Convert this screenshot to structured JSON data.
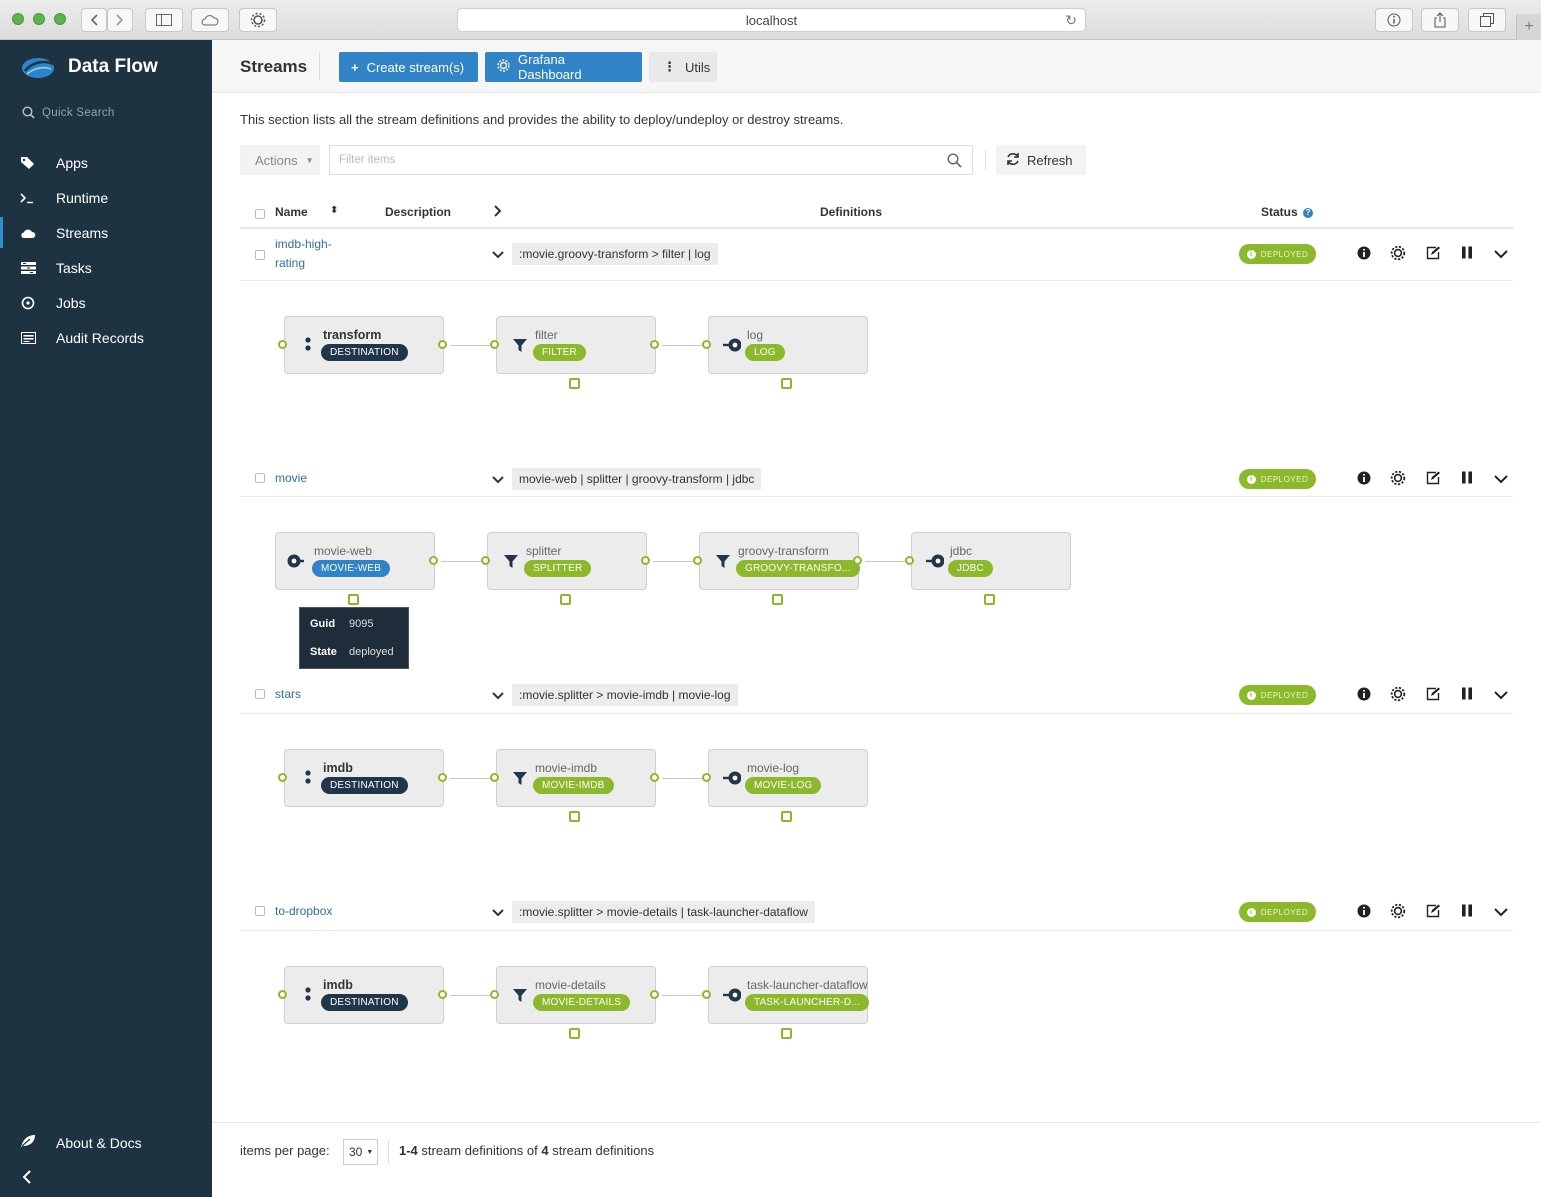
{
  "browser": {
    "url": "localhost"
  },
  "app": {
    "title": "Data Flow",
    "search_placeholder": "Quick Search"
  },
  "sidebar": {
    "items": [
      {
        "label": "Apps"
      },
      {
        "label": "Runtime"
      },
      {
        "label": "Streams",
        "active": true
      },
      {
        "label": "Tasks"
      },
      {
        "label": "Jobs"
      },
      {
        "label": "Audit Records"
      }
    ],
    "about_label": "About & Docs"
  },
  "toolbar": {
    "page_title": "Streams",
    "create_label": "Create stream(s)",
    "grafana_label": "Grafana Dashboard",
    "utils_label": "Utils"
  },
  "description": "This section lists all the stream definitions and provides the ability to deploy/undeploy or destroy streams.",
  "filter": {
    "actions_label": "Actions",
    "placeholder": "Filter items",
    "refresh_label": "Refresh"
  },
  "table": {
    "headers": {
      "name": "Name",
      "description": "Description",
      "definitions": "Definitions",
      "status": "Status"
    },
    "rows": [
      {
        "name": "imdb-high-rating",
        "definition": ":movie.groovy-transform > filter | log",
        "status": "DEPLOYED",
        "nodes": [
          {
            "label": "transform",
            "tag": "DESTINATION",
            "kind": "destination"
          },
          {
            "label": "filter",
            "tag": "FILTER",
            "kind": "processor"
          },
          {
            "label": "log",
            "tag": "LOG",
            "kind": "sink"
          }
        ]
      },
      {
        "name": "movie",
        "definition": "movie-web | splitter | groovy-transform | jdbc",
        "status": "DEPLOYED",
        "nodes": [
          {
            "label": "movie-web",
            "tag": "MOVIE-WEB",
            "kind": "source"
          },
          {
            "label": "splitter",
            "tag": "SPLITTER",
            "kind": "processor"
          },
          {
            "label": "groovy-transform",
            "tag": "GROOVY-TRANSFO...",
            "kind": "processor"
          },
          {
            "label": "jdbc",
            "tag": "JDBC",
            "kind": "sink"
          }
        ],
        "tooltip": {
          "guid_key": "Guid",
          "guid_value": "9095",
          "state_key": "State",
          "state_value": "deployed"
        }
      },
      {
        "name": "stars",
        "definition": ":movie.splitter > movie-imdb | movie-log",
        "status": "DEPLOYED",
        "nodes": [
          {
            "label": "imdb",
            "tag": "DESTINATION",
            "kind": "destination"
          },
          {
            "label": "movie-imdb",
            "tag": "MOVIE-IMDB",
            "kind": "processor"
          },
          {
            "label": "movie-log",
            "tag": "MOVIE-LOG",
            "kind": "sink"
          }
        ]
      },
      {
        "name": "to-dropbox",
        "definition": ":movie.splitter > movie-details | task-launcher-dataflow",
        "status": "DEPLOYED",
        "nodes": [
          {
            "label": "imdb",
            "tag": "DESTINATION",
            "kind": "destination"
          },
          {
            "label": "movie-details",
            "tag": "MOVIE-DETAILS",
            "kind": "processor"
          },
          {
            "label": "task-launcher-dataflow",
            "tag": "TASK-LAUNCHER-D...",
            "kind": "sink"
          }
        ]
      }
    ]
  },
  "footer": {
    "items_per_page_label": "items per page:",
    "items_per_page": "30",
    "range": "1-4",
    "range_mid": " stream definitions of ",
    "total": "4",
    "range_tail": " stream definitions"
  },
  "colors": {
    "sidebar": "#1e3342",
    "accent": "#2f83c6",
    "status_green": "#8cb82b",
    "link_text": "#2f6f9c"
  }
}
